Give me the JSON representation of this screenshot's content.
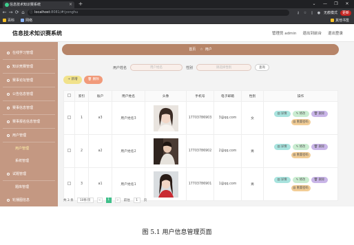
{
  "browser": {
    "tab_title": "信息技术知识赛系统",
    "tab_close": "×",
    "new_tab": "+",
    "win_controls": [
      "⌄",
      "—",
      "❐",
      "✕"
    ],
    "nav_icons": [
      "←",
      "→",
      "⟳",
      "⌂"
    ],
    "url_host": "localhost",
    "url_path": ":8081/#/yonghu",
    "guest_label": "无痕模式",
    "update_label": "更新",
    "bookmarks": [
      "百科",
      "网络"
    ],
    "bookmarks_right": "其他书签"
  },
  "header": {
    "title": "信息技术知识赛系统",
    "links": [
      "管理员 admin",
      "退出到前台",
      "退出登录"
    ]
  },
  "sidebar": {
    "items": [
      {
        "label": "在线学习管理",
        "type": "group"
      },
      {
        "label": "知识竞赛管理",
        "type": "group"
      },
      {
        "label": "赛事论坛管理",
        "type": "group"
      },
      {
        "label": "公告信息管理",
        "type": "group"
      },
      {
        "label": "赛事信息管理",
        "type": "group"
      },
      {
        "label": "赛事报名信息管理",
        "type": "group"
      },
      {
        "label": "用户管理",
        "type": "group"
      },
      {
        "label": "用户管理",
        "type": "sub",
        "active": true
      },
      {
        "label": "系统管理",
        "type": "sub",
        "active": false
      },
      {
        "label": "试题管理",
        "type": "group"
      },
      {
        "label": "题库管理",
        "type": "sub",
        "active": false
      },
      {
        "label": "轮播图信息",
        "type": "group"
      }
    ]
  },
  "breadcrumb": {
    "home": "首页",
    "star": "☆",
    "current": "用户"
  },
  "search": {
    "name_label": "用户姓名",
    "name_placeholder": "用户姓名",
    "gender_label": "性别",
    "gender_placeholder": "请选择性别",
    "query_button": "查询"
  },
  "toolbar": {
    "add_label": "+ 新增",
    "delete_label": "🗑 删除"
  },
  "table": {
    "headers": [
      "",
      "索引",
      "账户",
      "用户姓名",
      "头像",
      "手机号",
      "电子邮箱",
      "性别",
      "操作"
    ],
    "rows": [
      {
        "index": "1",
        "account": "a3",
        "name": "用户姓名3",
        "phone": "17703786903",
        "email": "3@qq.com",
        "gender": "女"
      },
      {
        "index": "2",
        "account": "a2",
        "name": "用户姓名2",
        "phone": "17703786902",
        "email": "2@qq.com",
        "gender": "男"
      },
      {
        "index": "3",
        "account": "a1",
        "name": "用户姓名1",
        "phone": "17703786901",
        "email": "1@qq.com",
        "gender": "男"
      }
    ],
    "actions": {
      "detail": "详情",
      "edit": "修改",
      "delete": "删除",
      "reset": "重置密码"
    }
  },
  "pager": {
    "total": "共 3 条",
    "page_size": "10条/页",
    "prev": "<",
    "current": "1",
    "next": ">",
    "goto": "前往",
    "goto_value": "1",
    "page_unit": "页"
  },
  "caption": "图 5.1 用户信息管理页面",
  "colors": {
    "sidebar": "#c49882",
    "breadcrumb": "#b68468",
    "add_button": "#f1e28b",
    "delete_button": "#f19a7a",
    "pager_active": "#3fbf8a"
  }
}
